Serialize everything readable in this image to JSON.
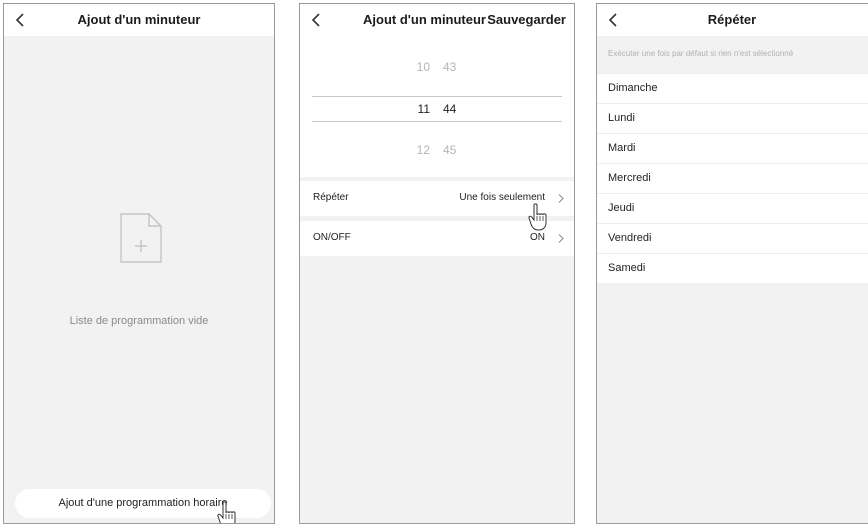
{
  "screen1": {
    "title": "Ajout d'un minuteur",
    "empty_icon": "add-document-icon",
    "empty_text": "Liste de programmation vide",
    "add_button_label": "Ajout d'une programmation horaire"
  },
  "screen2": {
    "title": "Ajout d'un minuteur",
    "save_label": "Sauvegarder",
    "picker": {
      "rows": [
        {
          "hour": "10",
          "minute": "43",
          "selected": false
        },
        {
          "hour": "11",
          "minute": "44",
          "selected": true
        },
        {
          "hour": "12",
          "minute": "45",
          "selected": false
        }
      ]
    },
    "repeat": {
      "label": "Répéter",
      "value": "Une fois seulement"
    },
    "onoff": {
      "label": "ON/OFF",
      "value": "ON"
    }
  },
  "screen3": {
    "title": "Répéter",
    "hint": "Exécuter une fois par défaut si rien n'est sélectionné",
    "days": [
      "Dimanche",
      "Lundi",
      "Mardi",
      "Mercredi",
      "Jeudi",
      "Vendredi",
      "Samedi"
    ]
  },
  "icons": {
    "back": "chevron-left-icon",
    "chevron": "chevron-right-icon",
    "pointer": "hand-pointer-icon"
  },
  "colors": {
    "background": "#f2f2f2",
    "surface": "#ffffff",
    "text": "#222222",
    "muted": "#8a8a8a",
    "divider": "#c8c8c8",
    "frame": "#9a9a9a"
  }
}
